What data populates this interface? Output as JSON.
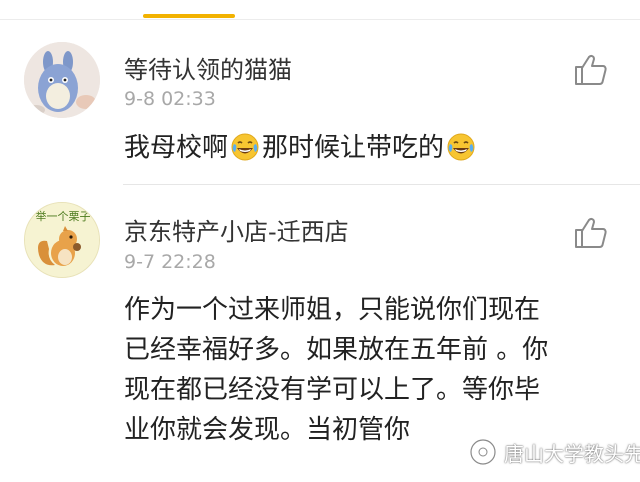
{
  "comments": [
    {
      "username": "等待认领的猫猫",
      "time": "9-8 02:33",
      "text_parts": [
        "我母校啊",
        "那时候让带吃的"
      ],
      "emoji": "laugh-cry-emoji"
    },
    {
      "username": "京东特产小店-迁西店",
      "time": "9-7 22:28",
      "avatar_text": "举一个栗子",
      "lines": [
        "作为一个过来师姐，只能说你们现在",
        "已经幸福好多。如果放在五年前 。你",
        "现在都已经没有学可以上了。等你毕",
        "业你就会发现。当初管你"
      ]
    }
  ],
  "watermark": {
    "text": "唐山大学教头先知"
  },
  "colors": {
    "accent": "#f2b200",
    "username": "#333333",
    "time": "#a8a8a8",
    "text": "#222222"
  }
}
